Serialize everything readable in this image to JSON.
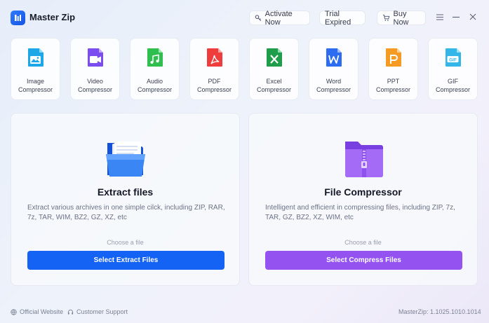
{
  "app": {
    "title": "Master Zip"
  },
  "header": {
    "activate_label": "Activate Now",
    "trial_label": "Trial Expired",
    "buy_label": "Buy Now"
  },
  "tools": [
    {
      "line1": "Image",
      "line2": "Compressor",
      "icon": "image-icon",
      "color": "#1ea7e8"
    },
    {
      "line1": "Video",
      "line2": "Compressor",
      "icon": "video-icon",
      "color": "#7b4cf0"
    },
    {
      "line1": "Audio",
      "line2": "Compressor",
      "icon": "audio-icon",
      "color": "#2fbf4f"
    },
    {
      "line1": "PDF",
      "line2": "Compressor",
      "icon": "pdf-icon",
      "color": "#ef3d3d"
    },
    {
      "line1": "Excel",
      "line2": "Compressor",
      "icon": "excel-icon",
      "color": "#1f9d4a"
    },
    {
      "line1": "Word",
      "line2": "Compressor",
      "icon": "word-icon",
      "color": "#2b6cf0"
    },
    {
      "line1": "PPT",
      "line2": "Compressor",
      "icon": "ppt-icon",
      "color": "#f59a23"
    },
    {
      "line1": "GIF",
      "line2": "Compressor",
      "icon": "gif-icon",
      "color": "#34b6e8"
    }
  ],
  "extract": {
    "title": "Extract files",
    "description": "Extract various archives in one simple cilck, including ZIP, RAR, 7z, TAR, WIM, BZ2, GZ, XZ, etc",
    "choose": "Choose a file",
    "button": "Select Extract Files",
    "button_color": "#1463f5",
    "icon": "folder-icon"
  },
  "compress": {
    "title": "File Compressor",
    "description": "Intelligent and efficient in compressing files, including ZIP, 7z, TAR, GZ, BZ2, XZ, WIM, etc",
    "choose": "Choose a file",
    "button": "Select Compress Files",
    "button_color": "#9452f0",
    "icon": "zip-folder-icon"
  },
  "footer": {
    "website": "Official Website",
    "support": "Customer Support",
    "version": "MasterZip: 1.1025.1010.1014"
  }
}
